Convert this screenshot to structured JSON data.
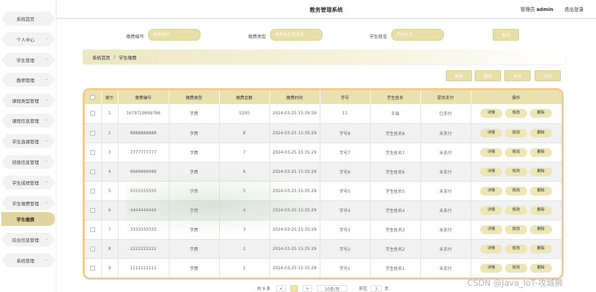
{
  "sidebar": {
    "items": [
      {
        "label": "系统首页",
        "chevron": false
      },
      {
        "label": "个人中心",
        "chevron": true
      },
      {
        "label": "学生管理",
        "chevron": true
      },
      {
        "label": "教师管理",
        "chevron": true
      },
      {
        "label": "课程类型管理",
        "chevron": true
      },
      {
        "label": "课程信息管理",
        "chevron": true
      },
      {
        "label": "学生选课管理",
        "chevron": true
      },
      {
        "label": "班级信息管理",
        "chevron": true
      },
      {
        "label": "学生成绩管理",
        "chevron": true
      },
      {
        "label": "学生缴费管理",
        "chevron": true
      },
      {
        "label": "学生缴费",
        "chevron": false,
        "active": true
      },
      {
        "label": "综合信息管理",
        "chevron": true
      },
      {
        "label": "系统管理",
        "chevron": true
      }
    ],
    "chevron_glyph": "⌄"
  },
  "header": {
    "title": "教务管理系统",
    "user_role": "管理员",
    "user_name": "admin",
    "logout": "退出登录"
  },
  "search": {
    "fee_no_label": "缴费编号",
    "fee_no_placeholder": "缴费编号",
    "fee_type_label": "缴费类型",
    "fee_type_placeholder": "缴费类型请选择",
    "student_name_label": "学生姓名",
    "student_name_placeholder": "学生姓名",
    "query_button": "查询"
  },
  "breadcrumb": {
    "home": "系统首页",
    "separator": "/",
    "current": "学生缴费"
  },
  "actions": {
    "add": "新增",
    "delete": "删除",
    "export": "导出",
    "print": "打印"
  },
  "table": {
    "headers": [
      "",
      "索引",
      "缴费编号",
      "缴费类型",
      "缴费金额",
      "缴费时间",
      "学号",
      "学生姓名",
      "是否支付",
      "操作"
    ],
    "row_buttons": {
      "detail": "详情",
      "edit": "修改",
      "delete": "删除"
    },
    "rows": [
      {
        "index": "1",
        "fee_no": "1679729999786",
        "type": "学费",
        "amount": "5200",
        "time": "2024-03-25 15:39:59",
        "student_no": "11",
        "student_name": "王瑞",
        "paid": "已支付"
      },
      {
        "index": "2",
        "fee_no": "8888888888",
        "type": "学费",
        "amount": "8",
        "time": "2024-03-25 15:35:29",
        "student_no": "学号8",
        "student_name": "学生姓名8",
        "paid": "未支付"
      },
      {
        "index": "3",
        "fee_no": "7777777777",
        "type": "学费",
        "amount": "7",
        "time": "2024-03-25 15:35:29",
        "student_no": "学号7",
        "student_name": "学生姓名7",
        "paid": "未支付"
      },
      {
        "index": "4",
        "fee_no": "6666666666",
        "type": "学费",
        "amount": "6",
        "time": "2024-03-25 15:35:29",
        "student_no": "学号6",
        "student_name": "学生姓名6",
        "paid": "未支付"
      },
      {
        "index": "5",
        "fee_no": "5555555555",
        "type": "学费",
        "amount": "5",
        "time": "2024-03-25 15:35:29",
        "student_no": "学号5",
        "student_name": "学生姓名5",
        "paid": "未支付"
      },
      {
        "index": "6",
        "fee_no": "4444444444",
        "type": "学费",
        "amount": "4",
        "time": "2024-03-25 15:35:29",
        "student_no": "学号4",
        "student_name": "学生姓名4",
        "paid": "未支付"
      },
      {
        "index": "7",
        "fee_no": "3333333333",
        "type": "学费",
        "amount": "3",
        "time": "2024-03-25 15:35:29",
        "student_no": "学号3",
        "student_name": "学生姓名3",
        "paid": "未支付"
      },
      {
        "index": "8",
        "fee_no": "2222222222",
        "type": "学费",
        "amount": "2",
        "time": "2024-03-25 15:35:29",
        "student_no": "学号2",
        "student_name": "学生姓名2",
        "paid": "未支付"
      },
      {
        "index": "9",
        "fee_no": "1111111111",
        "type": "学费",
        "amount": "1",
        "time": "2024-03-25 15:35:29",
        "student_no": "学号1",
        "student_name": "学生姓名1",
        "paid": "未支付"
      }
    ]
  },
  "pagination": {
    "total": "共 9 条",
    "prev": "<",
    "current_page": "1",
    "next": ">",
    "page_size": "10条/页",
    "goto_label": "前往",
    "goto_value": "1",
    "page_suffix": "页"
  },
  "watermark_text": "CSDN @Java_IoT-攻城狮",
  "colors": {
    "accent": "#e6dfa8",
    "table_border": "#f2c98f",
    "header_bg": "#e9e2b0"
  }
}
